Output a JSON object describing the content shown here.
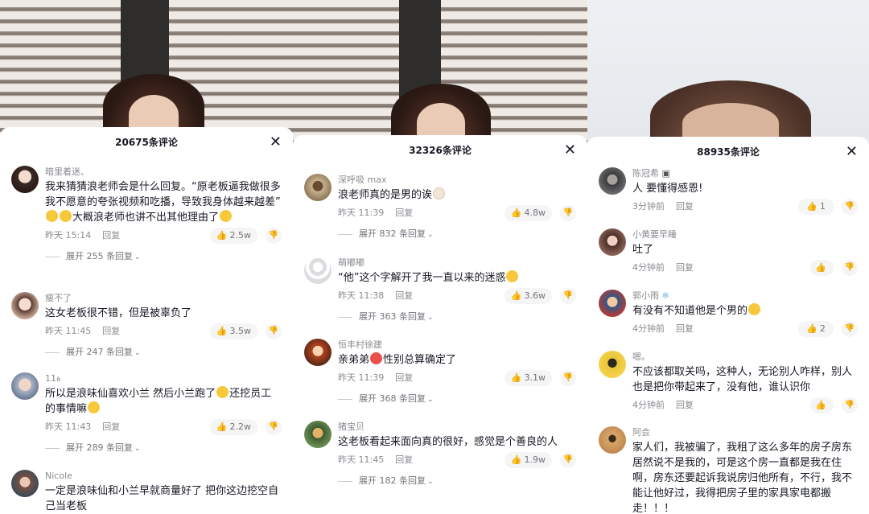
{
  "colors": {
    "text": "#161823",
    "meta": "#8a8b91",
    "accent": "#fe2c55"
  },
  "panels": [
    {
      "comment_count": "20675条评论",
      "close": "✕",
      "comments": [
        {
          "user": "暗里着迷、",
          "text": "我来猜猜浪老师会是什么回复。“原老板逼我做很多我不愿意的夸张视频和吃播，导致我身体越来越差”",
          "text2": "大概浪老师也讲不出其他理由了",
          "time": "昨天 15:14",
          "reply": "回复",
          "likes": "2.5w",
          "expand": "展开 255 条回复",
          "avatar": "avatar-1"
        },
        {
          "user": "瘦不了",
          "text": "这女老板很不错，但是被辜负了",
          "time": "昨天 11:45",
          "reply": "回复",
          "likes": "3.5w",
          "expand": "展开 247 条回复",
          "avatar": "avatar-2"
        },
        {
          "user": "ة11",
          "text": "所以是浪味仙喜欢小兰 然后小兰跑了",
          "text2": "还挖员工 的事情嘛",
          "time": "昨天 11:43",
          "reply": "回复",
          "likes": "2.2w",
          "expand": "展开 289 条回复",
          "avatar": "avatar-3"
        },
        {
          "user": "Nicole",
          "text": "一定是浪味仙和小兰早就商量好了 把你这边挖空自己当老板",
          "avatar": "avatar-4"
        }
      ]
    },
    {
      "comment_count": "32326条评论",
      "close": "✕",
      "comments": [
        {
          "user": "深呼吸 max",
          "text": "浪老师真的是男的诶",
          "time": "昨天 11:39",
          "reply": "回复",
          "likes": "4.8w",
          "expand": "展开 832 条回复",
          "avatar": "avatar-5"
        },
        {
          "user": "萌嘟嘟",
          "text": "“他”这个字解开了我一直以来的迷惑",
          "time": "昨天 11:38",
          "reply": "回复",
          "likes": "3.6w",
          "expand": "展开 363 条回复",
          "avatar": "avatar-6"
        },
        {
          "user": "恒丰村徐建",
          "text": "亲弟弟",
          "text2": "性别总算确定了",
          "time": "昨天 11:39",
          "reply": "回复",
          "likes": "3.1w",
          "expand": "展开 368 条回复",
          "avatar": "avatar-7"
        },
        {
          "user": "猪宝贝",
          "text": "这老板看起来面向真的很好，感觉是个善良的人",
          "time": "昨天 11:45",
          "reply": "回复",
          "likes": "1.9w",
          "expand": "展开 182 条回复",
          "avatar": "avatar-8"
        }
      ]
    },
    {
      "comment_count": "88935条评论",
      "close": "✕",
      "comments": [
        {
          "user": "陈冠希",
          "text": "人 要懂得感恩!",
          "time": "3分钟前",
          "reply": "回复",
          "likes": "1",
          "avatar": "avatar-9"
        },
        {
          "user": "小黄要早睡",
          "text": "吐了",
          "time": "4分钟前",
          "reply": "回复",
          "likes": "",
          "avatar": "avatar-10"
        },
        {
          "user": "郭小雨",
          "text": "有没有不知道他是个男的",
          "time": "4分钟前",
          "reply": "回复",
          "likes": "2",
          "avatar": "avatar-11"
        },
        {
          "user": "嗯。",
          "text": "不应该都取关吗，这种人，无论别人咋样，别人也是把你带起来了，没有他，谁认识你",
          "time": "4分钟前",
          "reply": "回复",
          "likes": "",
          "avatar": "avatar-12"
        },
        {
          "user": "阿会",
          "text": "家人们，我被骗了，我租了这么多年的房子房东居然说不是我的，可是这个房一直都是我在住啊，房东还要起诉我说房归他所有，不行，我不能让他好过，我得把房子里的家具家电都搬走！！！",
          "avatar": "avatar-13"
        }
      ]
    }
  ]
}
